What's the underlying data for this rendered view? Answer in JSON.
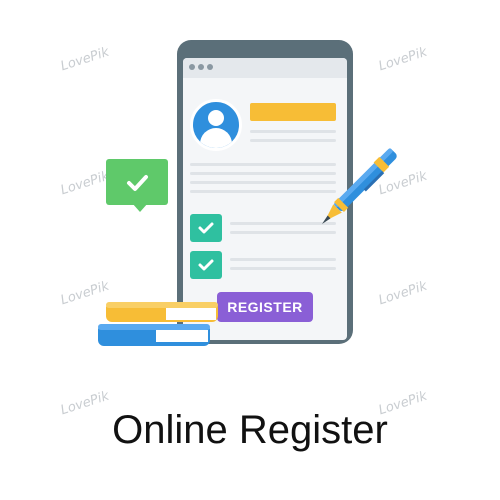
{
  "register_button": {
    "label": "REGISTER"
  },
  "caption": {
    "text": "Online Register"
  },
  "watermark": {
    "text": "LovePik"
  },
  "colors": {
    "phone_frame": "#5b6f79",
    "name_bar": "#f7bd36",
    "avatar": "#2f8fdd",
    "checkbox": "#2fc0a0",
    "bubble": "#5fc96a",
    "button": "#8a5fd6",
    "pen": "#2f8fdd"
  }
}
